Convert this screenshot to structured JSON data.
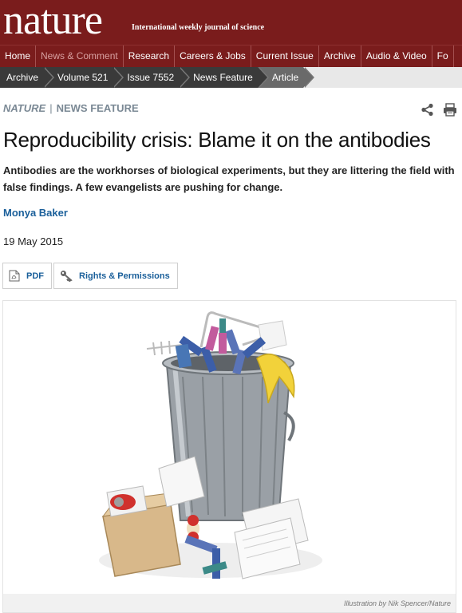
{
  "masthead": {
    "logo": "nature",
    "tagline": "International weekly journal of science",
    "color": "#7a1c1c"
  },
  "nav": {
    "items": [
      {
        "label": "Home"
      },
      {
        "label": "News & Comment",
        "active": true
      },
      {
        "label": "Research"
      },
      {
        "label": "Careers & Jobs"
      },
      {
        "label": "Current Issue"
      },
      {
        "label": "Archive"
      },
      {
        "label": "Audio & Video"
      },
      {
        "label": "Fo"
      }
    ]
  },
  "breadcrumb": {
    "items": [
      {
        "label": "Archive"
      },
      {
        "label": "Volume 521"
      },
      {
        "label": "Issue 7552"
      },
      {
        "label": "News Feature"
      },
      {
        "label": "Article"
      }
    ]
  },
  "article": {
    "journal": "NATURE",
    "section": "NEWS FEATURE",
    "title": "Reproducibility crisis: Blame it on the antibodies",
    "standfirst": "Antibodies are the workhorses of biological experiments, but they are littering the field with false findings. A few evangelists are pushing for change.",
    "author": "Monya Baker",
    "date": "19 May 2015",
    "tools": {
      "pdf_label": "PDF",
      "rights_label": "Rights & Permissions"
    },
    "figure": {
      "caption": "Illustration by Nik Spencer/Nature"
    }
  },
  "icons": {
    "share": "share-icon",
    "print": "print-icon",
    "pdf": "pdf-document-icon",
    "rights": "key-icon"
  },
  "colors": {
    "link": "#1a5f9a",
    "kicker": "#7a8894",
    "breadcrumb": "#3a3a3a"
  }
}
